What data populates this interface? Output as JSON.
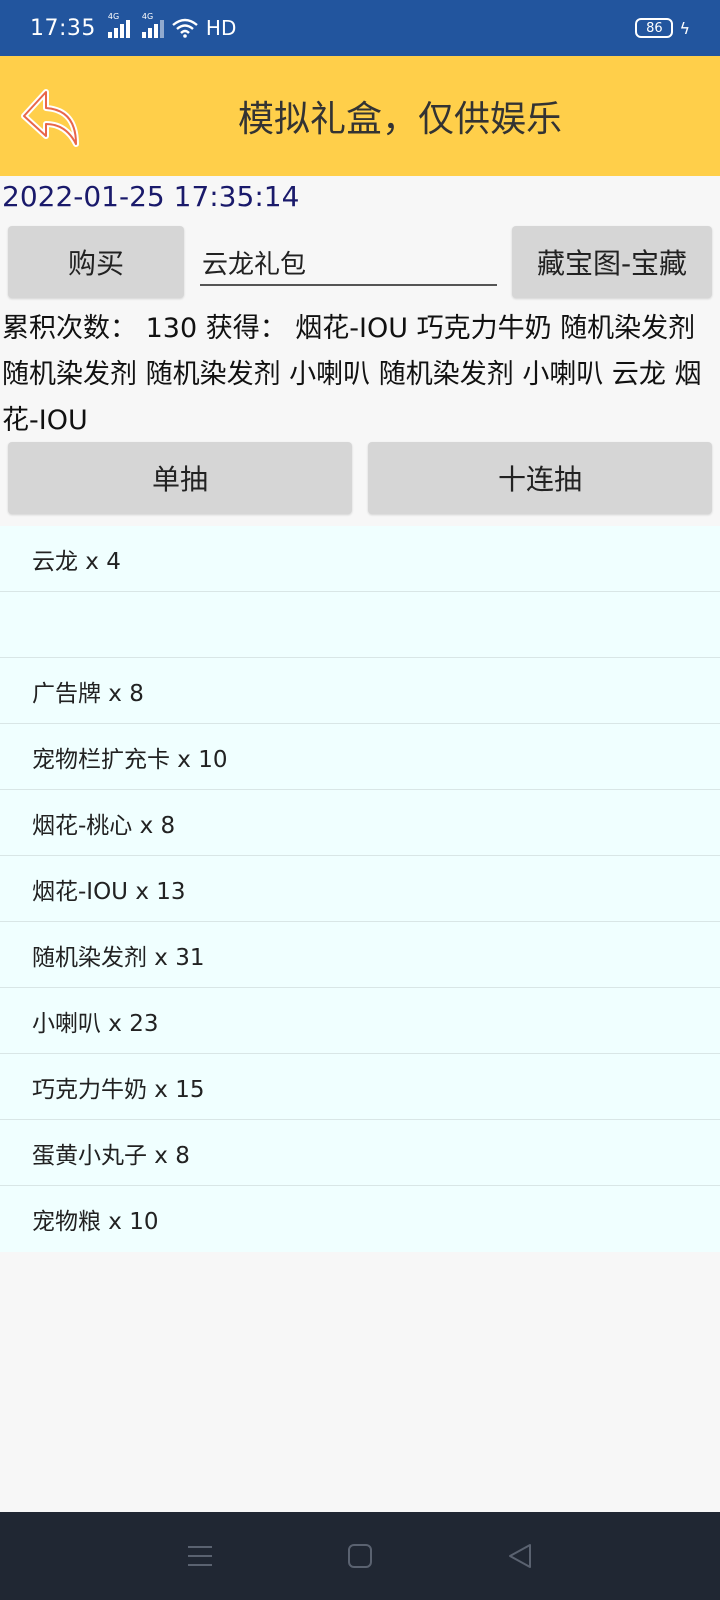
{
  "status_bar": {
    "time": "17:35",
    "network_1": "4G",
    "network_2": "4G",
    "hd_label": "HD",
    "battery": "86"
  },
  "header": {
    "title": "模拟礼盒，仅供娱乐",
    "accent_color": "#ffcf4a"
  },
  "datetime": "2022-01-25 17:35:14",
  "controls": {
    "buy_label": "购买",
    "package_value": "云龙礼包",
    "treasure_label": "藏宝图-宝藏",
    "single_draw_label": "单抽",
    "ten_draw_label": "十连抽"
  },
  "result": {
    "text": "累积次数： 130 获得：  烟花-IOU 巧克力牛奶 随机染发剂 随机染发剂 随机染发剂 小喇叭 随机染发剂 小喇叭 云龙 烟花-IOU"
  },
  "items": [
    "云龙 x 4",
    "",
    "广告牌 x 8",
    "宠物栏扩充卡 x 10",
    "烟花-桃心 x 8",
    "烟花-IOU x 13",
    "随机染发剂 x 31",
    "小喇叭 x 23",
    "巧克力牛奶 x 15",
    "蛋黄小丸子 x 8",
    "宠物粮 x 10"
  ],
  "nav": {
    "icons": [
      "menu-icon",
      "home-icon",
      "back-icon"
    ]
  }
}
